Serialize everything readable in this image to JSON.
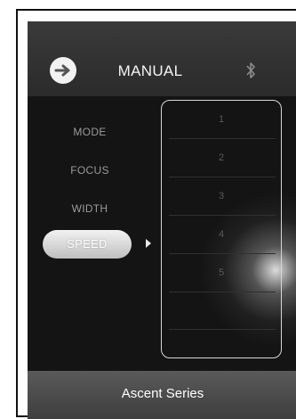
{
  "header": {
    "title": "MANUAL",
    "back_icon": "arrow-right-icon",
    "status_icon": "bluetooth-icon"
  },
  "menu": {
    "items": [
      {
        "label": "MODE",
        "active": false
      },
      {
        "label": "FOCUS",
        "active": false
      },
      {
        "label": "WIDTH",
        "active": false
      },
      {
        "label": "SPEED",
        "active": true
      }
    ]
  },
  "values": {
    "options": [
      "1",
      "2",
      "3",
      "4",
      "5"
    ]
  },
  "footer": {
    "label": "Ascent Series"
  },
  "colors": {
    "background": "#1e1e1e",
    "accent": "#f2f2f2"
  }
}
